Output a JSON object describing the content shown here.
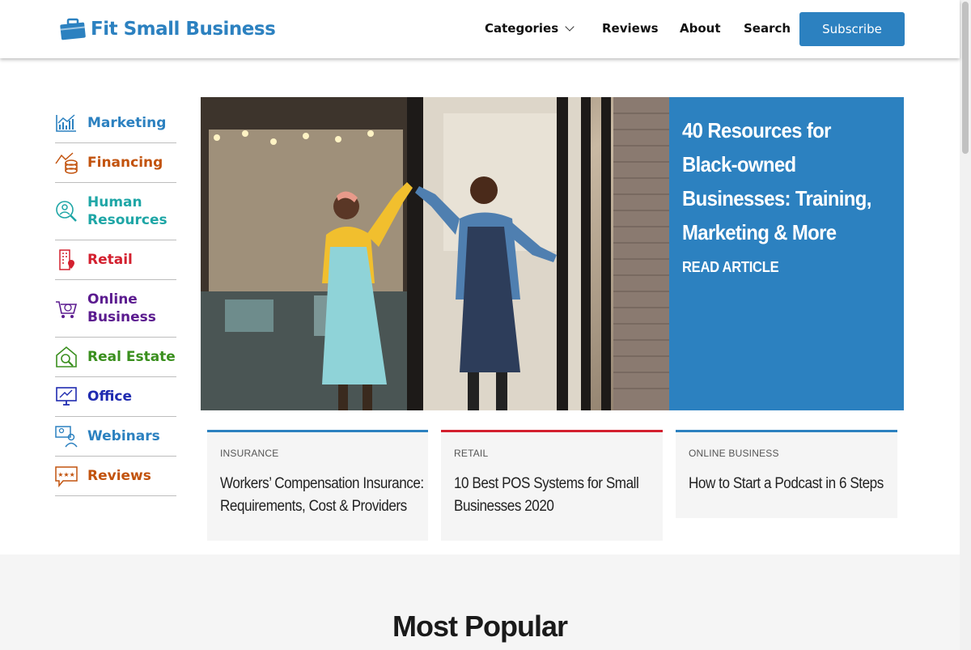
{
  "header": {
    "logo_text": "Fit Small Business",
    "nav": [
      {
        "label": "Categories"
      },
      {
        "label": "Reviews"
      },
      {
        "label": "About"
      },
      {
        "label": "Search"
      }
    ],
    "subscribe_label": "Subscribe",
    "brand_color": "#2c81c0"
  },
  "sidebar": {
    "items": [
      {
        "label": "Marketing",
        "icon": "chart-icon",
        "color": "#2c81c0"
      },
      {
        "label": "Financing",
        "icon": "coins-growth-icon",
        "color": "#c2530e"
      },
      {
        "label": "Human Resources",
        "icon": "person-search-icon",
        "color": "#1ea6a6"
      },
      {
        "label": "Retail",
        "icon": "building-pin-icon",
        "color": "#d3202f"
      },
      {
        "label": "Online Business",
        "icon": "shopping-cart-icon",
        "color": "#5b1b8f"
      },
      {
        "label": "Real Estate",
        "icon": "house-search-icon",
        "color": "#3a8f1e"
      },
      {
        "label": "Office",
        "icon": "monitor-icon",
        "color": "#1f2bb0"
      },
      {
        "label": "Webinars",
        "icon": "video-meeting-icon",
        "color": "#2c81c0"
      },
      {
        "label": "Reviews",
        "icon": "star-rating-icon",
        "color": "#c2530e"
      }
    ]
  },
  "hero": {
    "title": "40 Resources for Black-owned Businesses: Training, Marketing & More",
    "read_label": "READ ARTICLE",
    "image": "two-business-owners-high-five-photo"
  },
  "cards": [
    {
      "tag": "INSURANCE",
      "title": "Workers’ Compensation Insurance: Requirements, Cost & Providers",
      "accent": "#2c81c0"
    },
    {
      "tag": "RETAIL",
      "title": "10 Best POS Systems for Small Businesses 2020",
      "accent": "#d3202f"
    },
    {
      "tag": "ONLINE BUSINESS",
      "title": "How to Start a Podcast in 6 Steps",
      "accent": "#2c81c0"
    }
  ],
  "most_popular": {
    "title": "Most Popular"
  }
}
